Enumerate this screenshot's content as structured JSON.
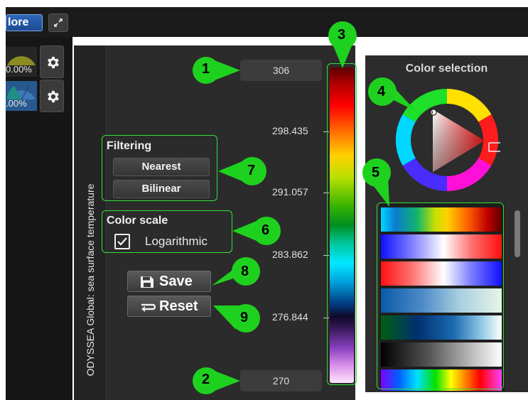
{
  "toolbar": {
    "more_label": "lore"
  },
  "layers": [
    {
      "percent": "0.00%",
      "selected": false
    },
    {
      "percent": ".00%",
      "selected": true
    }
  ],
  "layer_title": "ODYSSEA Global: sea surface temperature",
  "range": {
    "max": "306",
    "min": "270"
  },
  "scale_ticks": [
    "298.435",
    "291.057",
    "283.862",
    "276.844"
  ],
  "filtering": {
    "title": "Filtering",
    "options": [
      "Nearest",
      "Bilinear"
    ]
  },
  "color_scale": {
    "title": "Color scale",
    "logarithmic_label": "Logarithmic",
    "logarithmic_checked": true
  },
  "actions": {
    "save_label": "Save",
    "reset_label": "Reset"
  },
  "color_selection": {
    "title": "Color selection"
  },
  "callouts": [
    "1",
    "2",
    "3",
    "4",
    "5",
    "6",
    "7",
    "8",
    "9"
  ],
  "icons": {
    "collapse": "collapse-arrows-icon",
    "gear": "gear-icon",
    "save": "floppy-disk-icon",
    "reset": "return-arrow-icon",
    "check": "checkmark-icon"
  },
  "colors": {
    "callout_green": "#1fd11f",
    "highlight_green": "#35e035",
    "more_button_blue": "#2563b4"
  }
}
